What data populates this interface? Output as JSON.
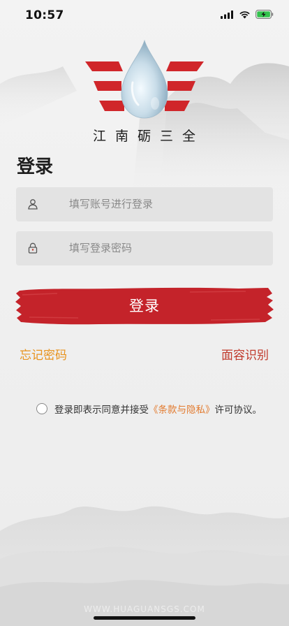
{
  "status_bar": {
    "time": "10:57"
  },
  "brand": {
    "name": "江南砺三全",
    "accent": "#d0262a"
  },
  "page_title": "登录",
  "form": {
    "account_placeholder": "填写账号进行登录",
    "password_placeholder": "填写登录密码"
  },
  "login_button": {
    "label": "登录",
    "color": "#c4232a"
  },
  "links": {
    "forgot_password": "忘记密码",
    "face_id": "面容识别"
  },
  "agreement": {
    "prefix": "登录即表示同意并接受",
    "terms_link": "《条款与隐私》",
    "suffix": "许可协议。",
    "checked": false
  },
  "watermark": "WWW.HUAGUANSGS.COM"
}
